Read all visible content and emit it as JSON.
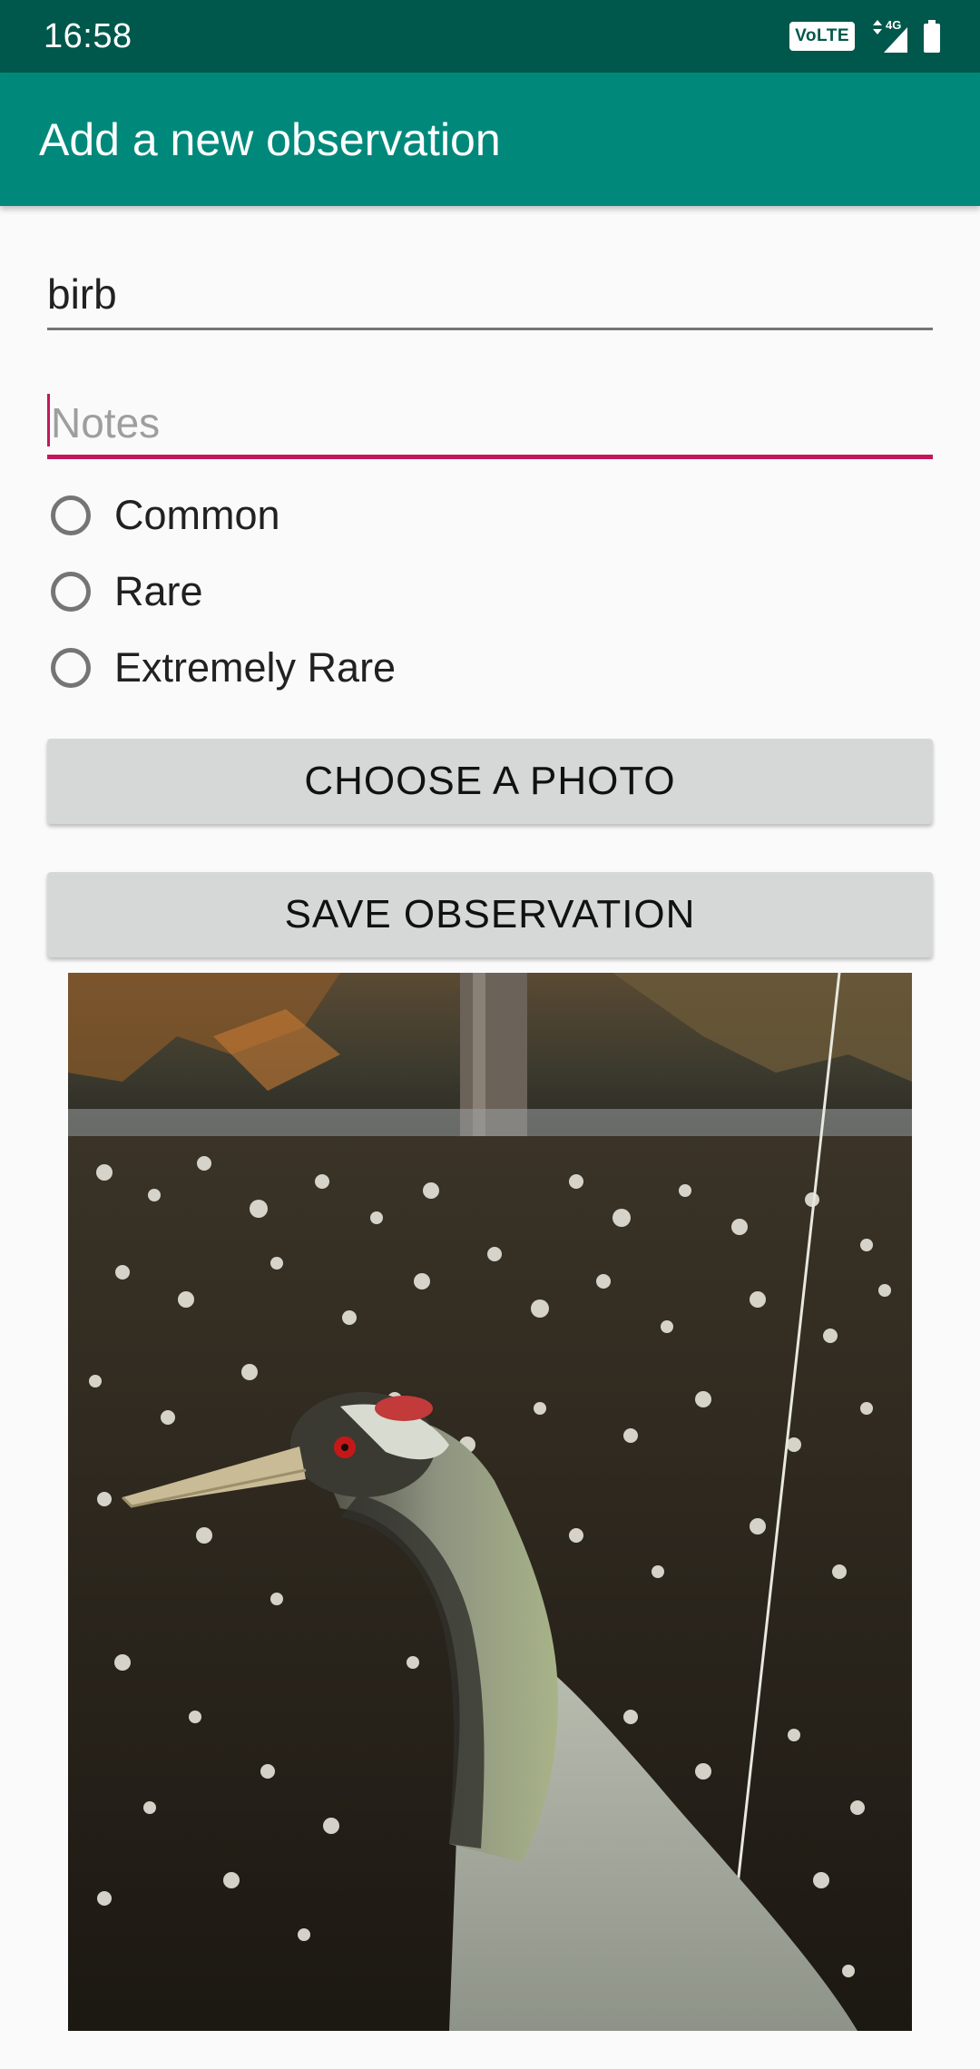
{
  "status_bar": {
    "time": "16:58",
    "volte_label": "VoLTE",
    "network_label": "4G",
    "icons": [
      "volte-icon",
      "data-arrows-icon",
      "signal-icon",
      "battery-icon"
    ]
  },
  "app_bar": {
    "title": "Add a new observation"
  },
  "form": {
    "name_field": {
      "value": "birb"
    },
    "notes_field": {
      "value": "",
      "placeholder": "Notes"
    },
    "rarity_options": [
      {
        "label": "Common",
        "selected": false
      },
      {
        "label": "Rare",
        "selected": false
      },
      {
        "label": "Extremely Rare",
        "selected": false
      }
    ],
    "choose_photo_label": "CHOOSE A PHOTO",
    "save_label": "SAVE OBSERVATION"
  },
  "photo": {
    "alt": "Crane in a meadow"
  },
  "colors": {
    "status_bar": "#00574b",
    "app_bar": "#00897b",
    "accent": "#c2185b",
    "button": "#d6d7d7",
    "background": "#fafafa"
  }
}
